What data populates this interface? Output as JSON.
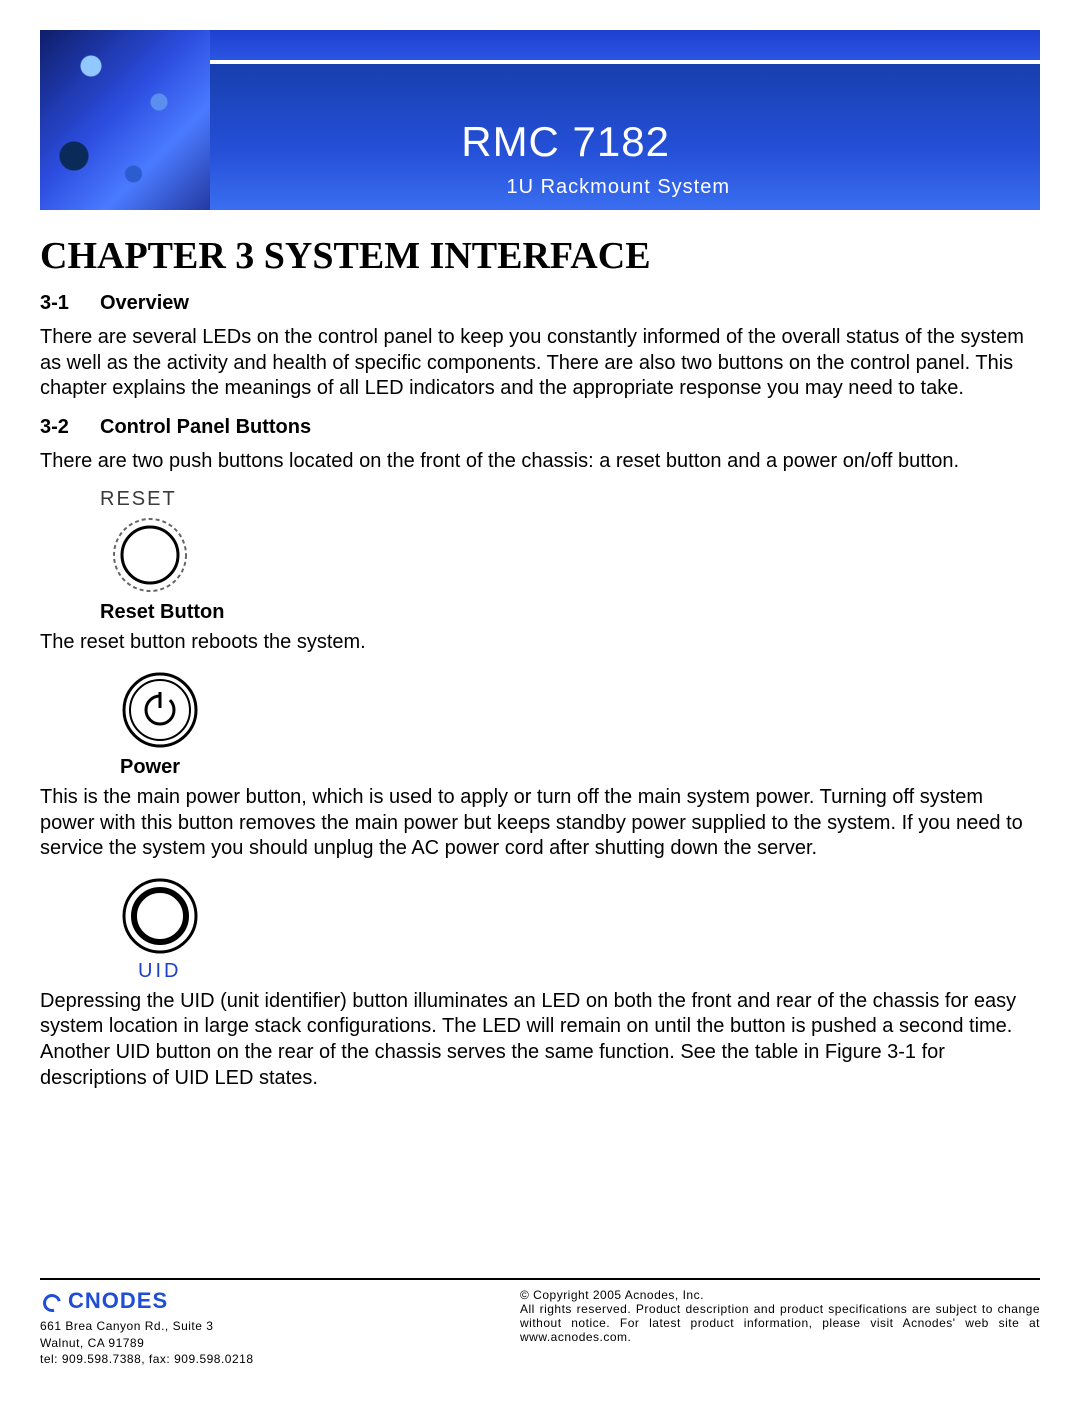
{
  "banner": {
    "title": "RMC 7182",
    "subtitle": "1U Rackmount System"
  },
  "chapter_title": "CHAPTER 3 SYSTEM INTERFACE",
  "sec31": {
    "num": "3-1",
    "title": "Overview",
    "body": "There are several LEDs on the control panel to keep you constantly informed of the overall status of the system as well as the activity and health of specific components. There are also two buttons on the control panel. This chapter explains the meanings of all LED indicators and the appropriate response you may need to take."
  },
  "sec32": {
    "num": "3-2",
    "title": "Control Panel Buttons",
    "intro": "There are two push buttons located on the front of the chassis: a reset button and a power on/off button."
  },
  "reset": {
    "fig_label": "RESET",
    "heading": "Reset Button",
    "body": "The reset button reboots the system."
  },
  "power": {
    "heading": "Power",
    "body": "This is the main power button, which is used to apply or turn off the main system power. Turning off system power with this button removes the main power but keeps standby power supplied to the system. If you need to service the system you should unplug the AC power cord after shutting down the server."
  },
  "uid": {
    "fig_label": "UID",
    "body": "Depressing the UID (unit identifier) button illuminates an LED on both the front and rear of the chassis for easy system location in large stack configurations. The LED will remain on until the button is pushed a second time. Another UID button on the rear of the chassis serves the same function. See the table in Figure 3-1 for descriptions of UID LED states."
  },
  "footer": {
    "logo_text": "CNODES",
    "addr1": "661 Brea Canyon Rd., Suite 3",
    "addr2": "Walnut, CA 91789",
    "addr3": "tel: 909.598.7388, fax: 909.598.0218",
    "copy1": "© Copyright 2005 Acnodes, Inc.",
    "copy2": "All rights reserved. Product description and product specifications are subject to change without notice. For latest product information, please visit Acnodes' web site at www.acnodes.com."
  }
}
